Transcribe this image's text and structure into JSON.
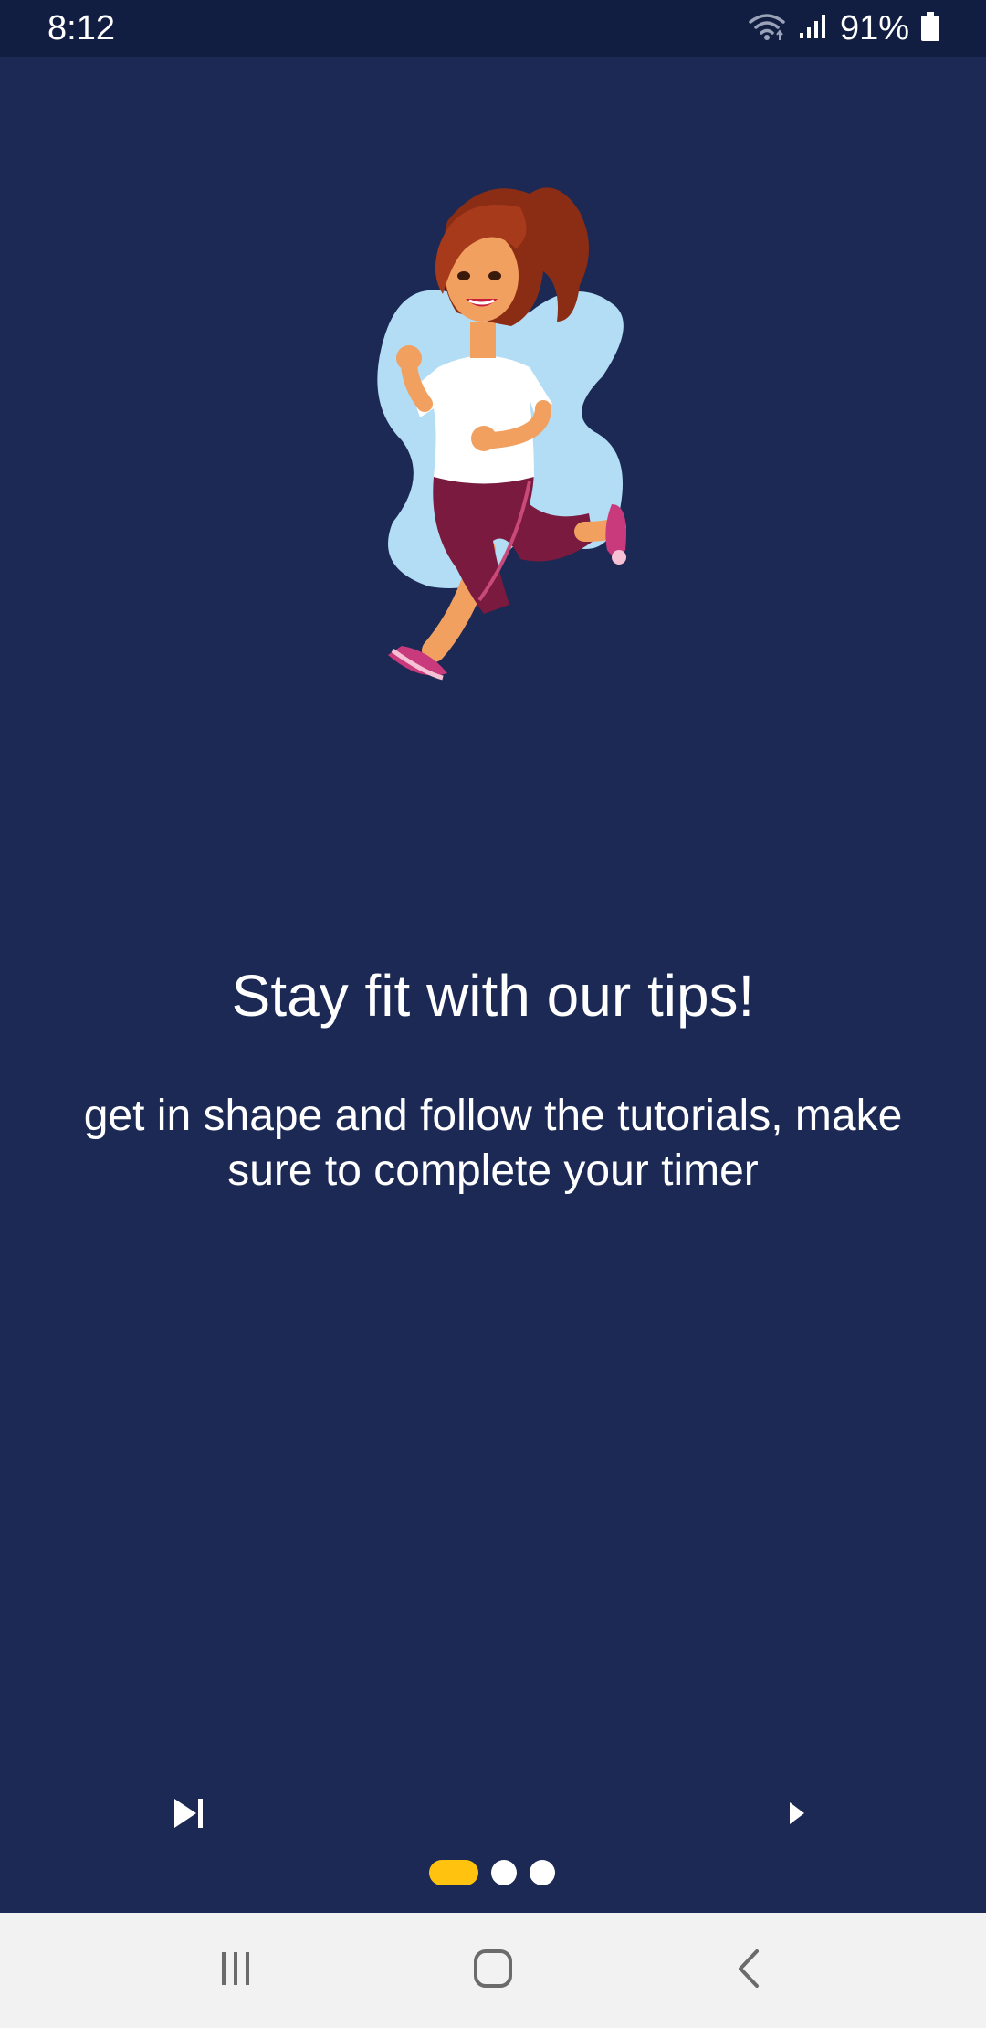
{
  "status_bar": {
    "time": "8:12",
    "battery_percent": "91%",
    "icons": [
      "wifi-icon",
      "signal-icon",
      "battery-icon"
    ]
  },
  "onboarding": {
    "illustration": "running-woman-illustration",
    "title": "Stay fit with our tips!",
    "subtitle": "get in shape and follow the tutorials, make sure to complete your timer",
    "page_index": 1,
    "page_count": 3
  },
  "controls": {
    "skip_icon": "skip-to-end-icon",
    "next_icon": "play-arrow-icon"
  },
  "nav_bar": {
    "buttons": [
      "recent-apps-icon",
      "home-icon",
      "back-icon"
    ]
  },
  "colors": {
    "background": "#1b2954",
    "status_bar": "#121d42",
    "accent": "#ffc20e",
    "text": "#ffffff",
    "nav_bar": "#f2f2f2"
  }
}
